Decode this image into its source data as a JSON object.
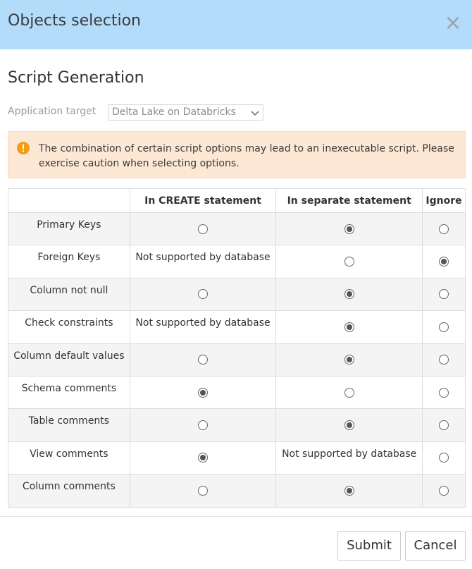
{
  "dialog": {
    "title": "Objects selection",
    "close_glyph": "×"
  },
  "section": {
    "title": "Script Generation",
    "target_label": "Application target",
    "target_value": "Delta Lake on Databricks"
  },
  "warning": {
    "icon": "warning-circle-icon",
    "text": "The combination of certain script options may lead to an inexecutable script. Please exercise caution when selecting options."
  },
  "table": {
    "headers": [
      "",
      "In CREATE statement",
      "In separate statement",
      "Ignore"
    ],
    "rows": [
      {
        "label": "Primary Keys",
        "cells": [
          {
            "type": "radio",
            "checked": false
          },
          {
            "type": "radio",
            "checked": true
          },
          {
            "type": "radio",
            "checked": false
          }
        ]
      },
      {
        "label": "Foreign Keys",
        "cells": [
          {
            "type": "text",
            "text": "Not supported by database"
          },
          {
            "type": "radio",
            "checked": false
          },
          {
            "type": "radio",
            "checked": true
          }
        ]
      },
      {
        "label": "Column not null",
        "cells": [
          {
            "type": "radio",
            "checked": false
          },
          {
            "type": "radio",
            "checked": true
          },
          {
            "type": "radio",
            "checked": false
          }
        ]
      },
      {
        "label": "Check constraints",
        "cells": [
          {
            "type": "text",
            "text": "Not supported by database"
          },
          {
            "type": "radio",
            "checked": true
          },
          {
            "type": "radio",
            "checked": false
          }
        ]
      },
      {
        "label": "Column default values",
        "cells": [
          {
            "type": "radio",
            "checked": false
          },
          {
            "type": "radio",
            "checked": true
          },
          {
            "type": "radio",
            "checked": false
          }
        ]
      },
      {
        "label": "Schema comments",
        "cells": [
          {
            "type": "radio",
            "checked": true
          },
          {
            "type": "radio",
            "checked": false
          },
          {
            "type": "radio",
            "checked": false
          }
        ]
      },
      {
        "label": "Table comments",
        "cells": [
          {
            "type": "radio",
            "checked": false
          },
          {
            "type": "radio",
            "checked": true
          },
          {
            "type": "radio",
            "checked": false
          }
        ]
      },
      {
        "label": "View comments",
        "cells": [
          {
            "type": "radio",
            "checked": true
          },
          {
            "type": "text",
            "text": "Not supported by database"
          },
          {
            "type": "radio",
            "checked": false
          }
        ]
      },
      {
        "label": "Column comments",
        "cells": [
          {
            "type": "radio",
            "checked": false
          },
          {
            "type": "radio",
            "checked": true
          },
          {
            "type": "radio",
            "checked": false
          }
        ]
      }
    ]
  },
  "footer": {
    "submit_label": "Submit",
    "cancel_label": "Cancel"
  },
  "colors": {
    "header_bg": "#b3dcfb",
    "warning_bg": "#fde8d6",
    "warning_icon": "#f39c12",
    "stripe_bg": "#f4f4f4"
  }
}
